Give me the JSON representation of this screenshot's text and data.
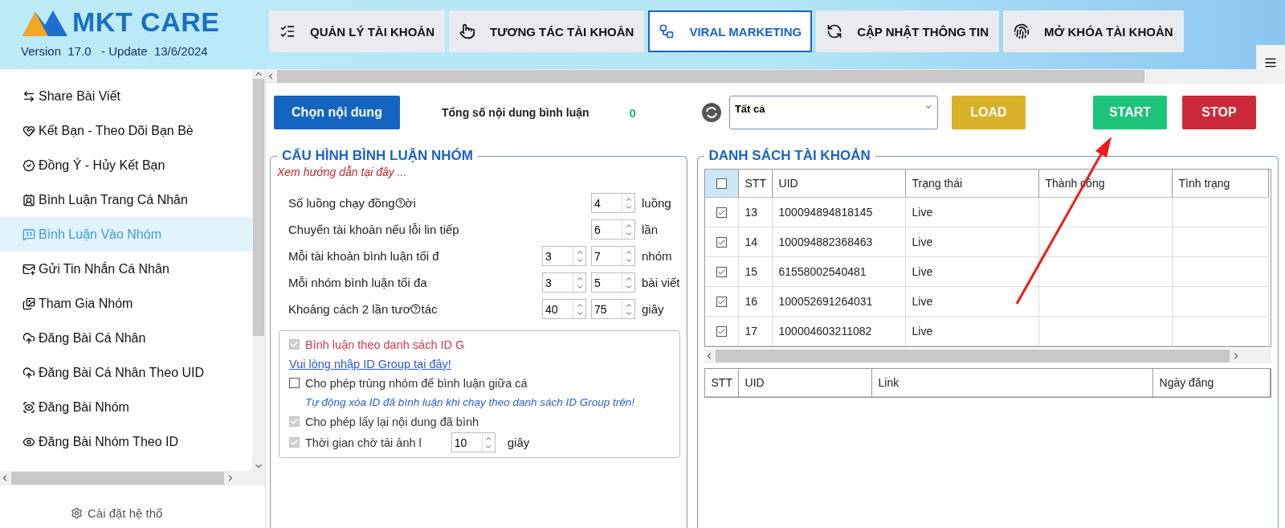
{
  "app": {
    "name": "MKT CARE",
    "version": "Version  17.0   - Update  13/6/2024"
  },
  "tabs": [
    {
      "label": "QUẢN LÝ TÀI KHOẢN",
      "selected": false
    },
    {
      "label": "TƯƠNG TÁC TÀI KHOẢN",
      "selected": false
    },
    {
      "label": "VIRAL MARKETING",
      "selected": true
    },
    {
      "label": "CẬP NHẬT THÔNG TIN",
      "selected": false
    },
    {
      "label": "MỞ KHÓA TÀI KHOẢN",
      "selected": false
    }
  ],
  "sidebar": {
    "items": [
      {
        "label": "Share Bài Viết",
        "selected": false
      },
      {
        "label": "Kết Bạn - Theo Dõi Bạn Bè",
        "selected": false
      },
      {
        "label": "Đồng Ý - Hủy Kết Bạn",
        "selected": false
      },
      {
        "label": "Bình Luận Trang Cá Nhân",
        "selected": false
      },
      {
        "label": "Bình Luận Vào Nhóm",
        "selected": true
      },
      {
        "label": "Gửi Tin Nhắn Cá Nhân",
        "selected": false
      },
      {
        "label": "Tham Gia Nhóm",
        "selected": false
      },
      {
        "label": "Đăng Bài Cá Nhân",
        "selected": false
      },
      {
        "label": "Đăng Bài Cá Nhân Theo UID",
        "selected": false
      },
      {
        "label": "Đăng Bài Nhóm",
        "selected": false
      },
      {
        "label": "Đăng Bài Nhóm Theo ID",
        "selected": false
      }
    ],
    "settings": "Cài đặt hệ thố"
  },
  "toolbar": {
    "choose_button": "Chọn nội dung",
    "count_label": "Tổng số nội dung bình luận",
    "count": "0",
    "filter": "Tất cả",
    "load_button": "LOAD",
    "start_button": "START",
    "stop_button": "STOP"
  },
  "config": {
    "title": "CẤU HÌNH BÌNH LUẬN NHÓM",
    "guide_link": "Xem hướng dẫn tại đây ...",
    "rows": [
      {
        "label": "Số luồng chạy đồng",
        "label_tail": "ời",
        "values": [
          "4"
        ],
        "unit": "luồng"
      },
      {
        "label": "Chuyển tài khoản nếu lỗi li",
        "label_tail": "n tiếp",
        "values": [
          "6"
        ],
        "unit": "lần"
      },
      {
        "label": "Mỗi tài khoản bình luận tối đ",
        "values": [
          "3",
          "7"
        ],
        "unit": "nhóm"
      },
      {
        "label": "Mỗi nhóm bình luận tối đa",
        "values": [
          "3",
          "5"
        ],
        "unit": "bài viết"
      },
      {
        "label": "Khoảng cách 2 lần tươ",
        "label_tail": "tác",
        "values": [
          "40",
          "75"
        ],
        "unit": "giây"
      }
    ],
    "options": [
      {
        "kind": "check",
        "label": "Bình luận theo danh sách ID G",
        "checked": true,
        "warning": true
      },
      {
        "kind": "link",
        "label": "Vui lòng nhập ID Group tại đây!"
      },
      {
        "kind": "check",
        "label": "Cho phép trùng nhóm để bình luận giữa cá",
        "checked": false,
        "warning": false
      },
      {
        "kind": "note",
        "label": "Tự động xóa ID đã bình luận khi chạy theo danh sách ID Group trên!"
      },
      {
        "kind": "check",
        "label": "Cho phép lấy lại nội dung đã bình",
        "checked": true,
        "warning": false
      },
      {
        "kind": "check_spin",
        "label": "Thời gian chờ tải ảnh l",
        "checked": true,
        "warning": false,
        "value": "10",
        "unit": "giây"
      }
    ]
  },
  "accounts": {
    "title": "DANH SÁCH TÀI KHOẢN",
    "all_checked": false,
    "columns": [
      "STT",
      "UID",
      "Trạng thái",
      "Thành công",
      "Tình trạng"
    ],
    "rows": [
      {
        "checked": true,
        "cells": [
          "13",
          "100094894818145",
          "Live",
          "",
          ""
        ]
      },
      {
        "checked": true,
        "cells": [
          "14",
          "100094882368463",
          "Live",
          "",
          ""
        ]
      },
      {
        "checked": true,
        "cells": [
          "15",
          "61558002540481",
          "Live",
          "",
          ""
        ]
      },
      {
        "checked": true,
        "cells": [
          "16",
          "100052691264031",
          "Live",
          "",
          ""
        ]
      },
      {
        "checked": true,
        "cells": [
          "17",
          "100004603211082",
          "Live",
          "",
          ""
        ]
      }
    ],
    "posts_columns": [
      "STT",
      "UID",
      "Link",
      "Ngày đăng"
    ]
  }
}
